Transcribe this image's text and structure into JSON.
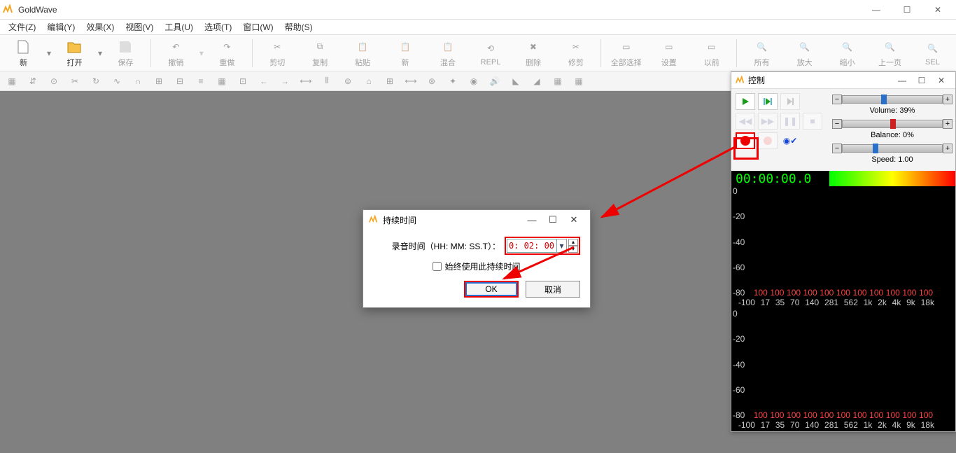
{
  "app": {
    "title": "GoldWave"
  },
  "menu": {
    "file": "文件(Z)",
    "edit": "编辑(Y)",
    "effect": "效果(X)",
    "view": "视图(V)",
    "tool": "工具(U)",
    "option": "选项(T)",
    "window": "窗口(W)",
    "help": "帮助(S)"
  },
  "toolbar1": {
    "new": "新",
    "open": "打开",
    "save": "保存",
    "undo": "撤销",
    "redo": "重做",
    "cut": "剪切",
    "copy": "复制",
    "paste": "粘贴",
    "new2": "新",
    "mix": "混合",
    "repl": "REPL",
    "delete": "删除",
    "trim": "修剪",
    "selall": "全部选择",
    "set": "设置",
    "prev": "以前",
    "all": "所有",
    "zoomin": "放大",
    "zoomout": "缩小",
    "prevpg": "上一页",
    "sel": "SEL"
  },
  "control": {
    "title": "控制",
    "volume_label": "Volume: 39%",
    "balance_label": "Balance: 0%",
    "speed_label": "Speed: 1.00",
    "time": "00:00:00.0",
    "spec_db": [
      "0",
      "-20",
      "-40",
      "-60",
      "-80"
    ],
    "spec_red": [
      "100",
      "100",
      "100",
      "100",
      "100",
      "100",
      "100",
      "100",
      "100",
      "100",
      "100"
    ],
    "spec_freq_lead": "-100",
    "spec_freq": [
      "17",
      "35",
      "70",
      "140",
      "281",
      "562",
      "1k",
      "2k",
      "4k",
      "9k",
      "18k"
    ]
  },
  "dialog": {
    "title": "持续时间",
    "label": "录音时间（HH: MM: SS.T）：",
    "value": "0: 02: 00",
    "checkbox": "始终使用此持续时间",
    "ok": "OK",
    "cancel": "取消"
  }
}
